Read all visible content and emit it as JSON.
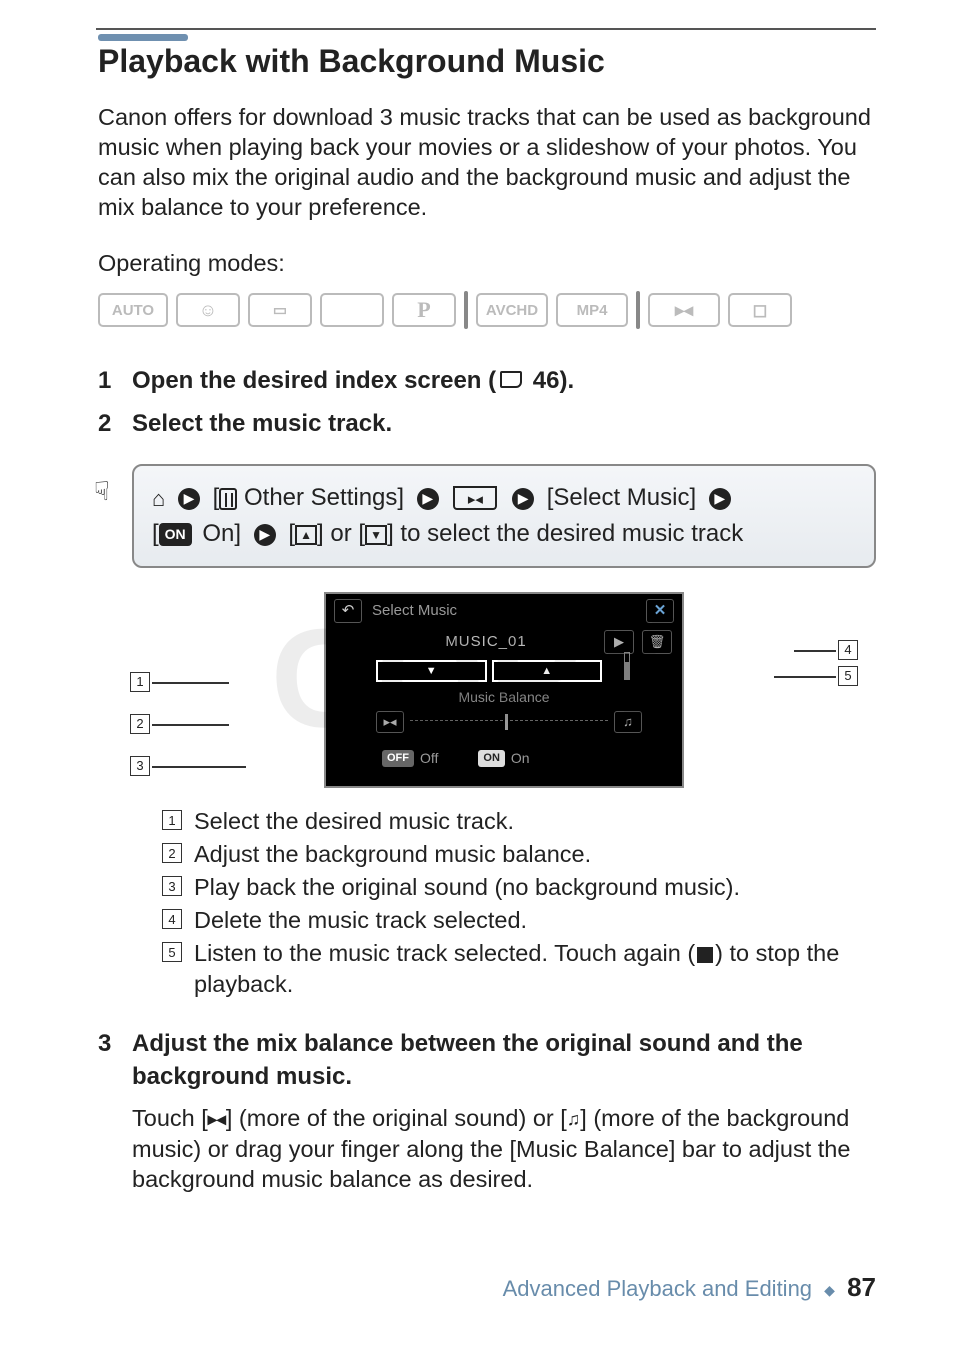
{
  "title": "Playback with Background Music",
  "intro": "Canon offers for download 3 music tracks that can be used as background music when playing back your movies or a slideshow of your photos. You can also mix the original audio and the background music and adjust the mix balance to your preference.",
  "operating_modes_label": "Operating modes:",
  "modes": {
    "auto": "AUTO",
    "p": "P",
    "avchd": "AVCHD",
    "mp4": "MP4"
  },
  "steps": {
    "s1": {
      "num": "1",
      "title_a": "Open the desired index screen (",
      "title_b": " 46)."
    },
    "s2": {
      "num": "2",
      "title": "Select the music track."
    },
    "s3": {
      "num": "3",
      "title": "Adjust the mix balance between the original sound and the background music.",
      "body_a": "Touch [",
      "body_b": "] (more of the original sound) or [",
      "body_c": "] (more of the background music) or drag your finger along the [Music Balance] bar to adjust the background music balance as desired."
    }
  },
  "navbox": {
    "other_settings": " Other Settings] ",
    "select_music": " [Select Music] ",
    "on": " On] ",
    "tail": " to select the desired music track"
  },
  "screenshot": {
    "title": "Select Music",
    "track": "MUSIC_01",
    "balance_label": "Music Balance",
    "off": "Off",
    "on": "On",
    "off_badge": "OFF",
    "on_badge": "ON"
  },
  "callouts": {
    "c1": "Select the desired music track.",
    "c2": "Adjust the background music balance.",
    "c3": "Play back the original sound (no background music).",
    "c4": "Delete the music track selected.",
    "c5a": "Listen to the music track selected. Touch again (",
    "c5b": ") to stop the playback."
  },
  "callout_nums": {
    "n1": "1",
    "n2": "2",
    "n3": "3",
    "n4": "4",
    "n5": "5"
  },
  "footer": {
    "section": "Advanced Playback and Editing",
    "page": "87"
  },
  "watermark": "COPY"
}
